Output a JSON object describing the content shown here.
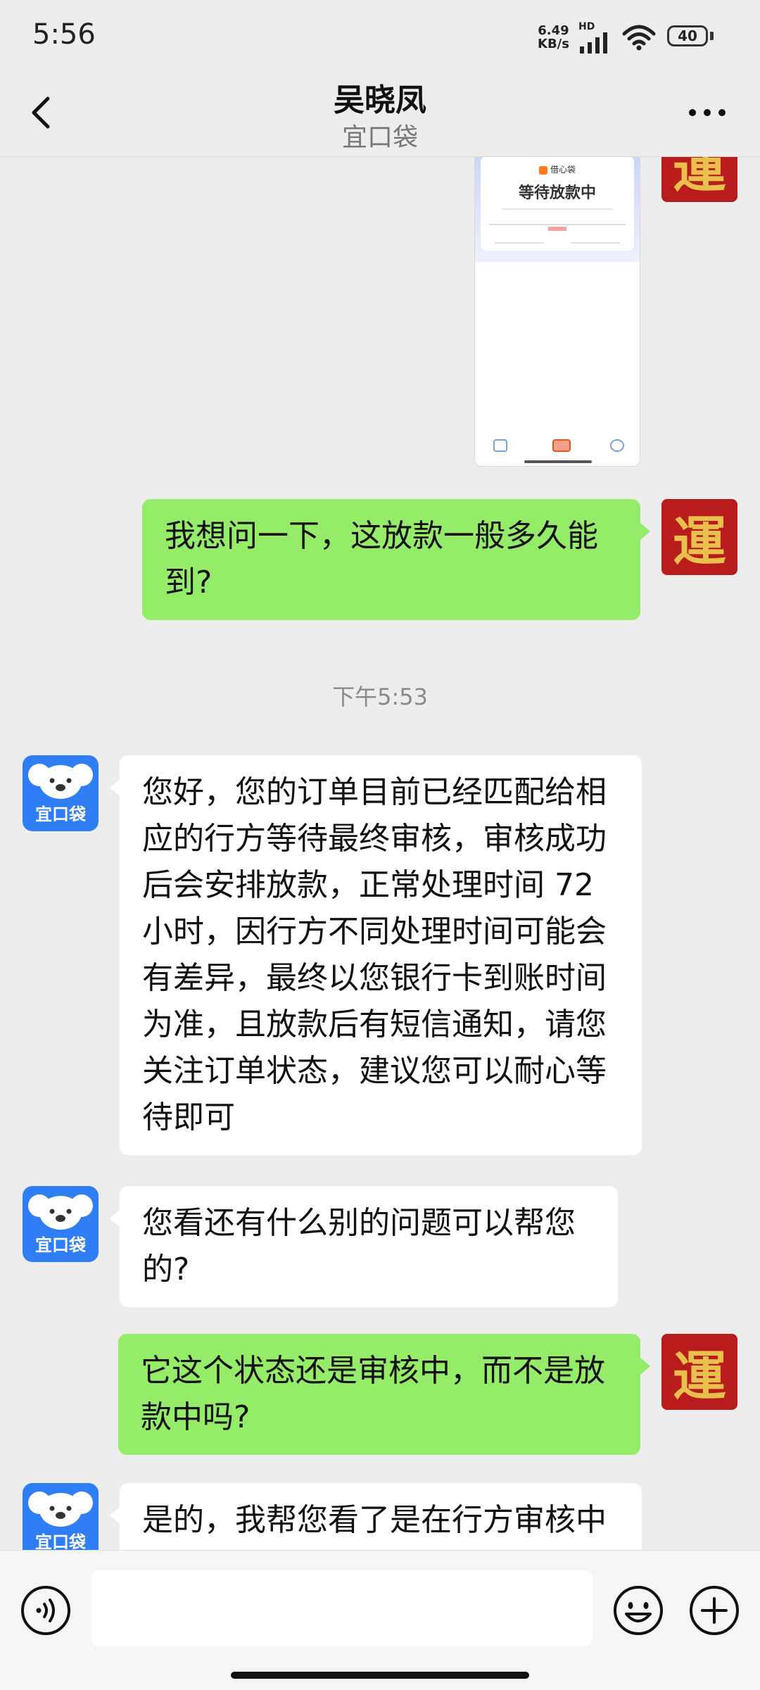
{
  "status_bar": {
    "time": "5:56",
    "net_speed_value": "6.49",
    "net_speed_unit": "KB/s",
    "network_tag": "HD",
    "battery": "40"
  },
  "header": {
    "title": "吴晓凤",
    "subtitle": "宜口袋"
  },
  "screenshot_preview": {
    "app_name": "借心袋",
    "status": "等待放款中"
  },
  "messages": [
    {
      "from": "me",
      "text": "我想问一下，这放款一般多久能到?"
    },
    {
      "type": "timestamp",
      "text": "下午5:53"
    },
    {
      "from": "them",
      "text": "您好，您的订单目前已经匹配给相应的行方等待最终审核，审核成功后会安排放款，正常处理时间 72 小时，因行方不同处理时间可能会有差异，最终以您银行卡到账时间为准，且放款后有短信通知，请您关注订单状态，建议您可以耐心等待即可"
    },
    {
      "from": "them",
      "text": "您看还有什么别的问题可以帮您的?"
    },
    {
      "from": "me",
      "text": "它这个状态还是审核中，而不是放款中吗?"
    },
    {
      "from": "them",
      "text": "是的，我帮您看了是在行方审核中"
    }
  ],
  "avatars": {
    "me_char": "運",
    "them_label": "宜口袋"
  },
  "input": {
    "value": "",
    "placeholder": ""
  },
  "colors": {
    "my_bubble": "#95ec69",
    "their_bubble": "#ffffff",
    "background": "#ededed",
    "my_avatar": "#b91c1c",
    "their_avatar": "#2f7ef6"
  }
}
